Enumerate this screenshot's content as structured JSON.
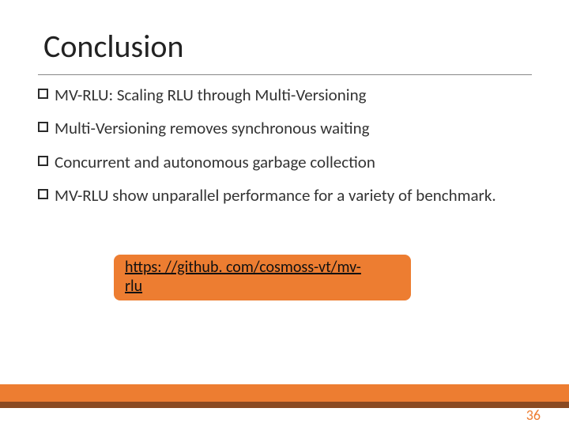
{
  "title": "Conclusion",
  "bullets": [
    "MV-RLU: Scaling RLU through Multi-Versioning",
    "Multi-Versioning removes synchronous waiting",
    "Concurrent and autonomous garbage collection",
    "MV-RLU show unparallel performance for a variety of benchmark."
  ],
  "url_line1": "https: //github. com/cosmoss-vt/mv-",
  "url_line2": "rlu",
  "page_number": "36",
  "accent_color": "#ed7d31"
}
